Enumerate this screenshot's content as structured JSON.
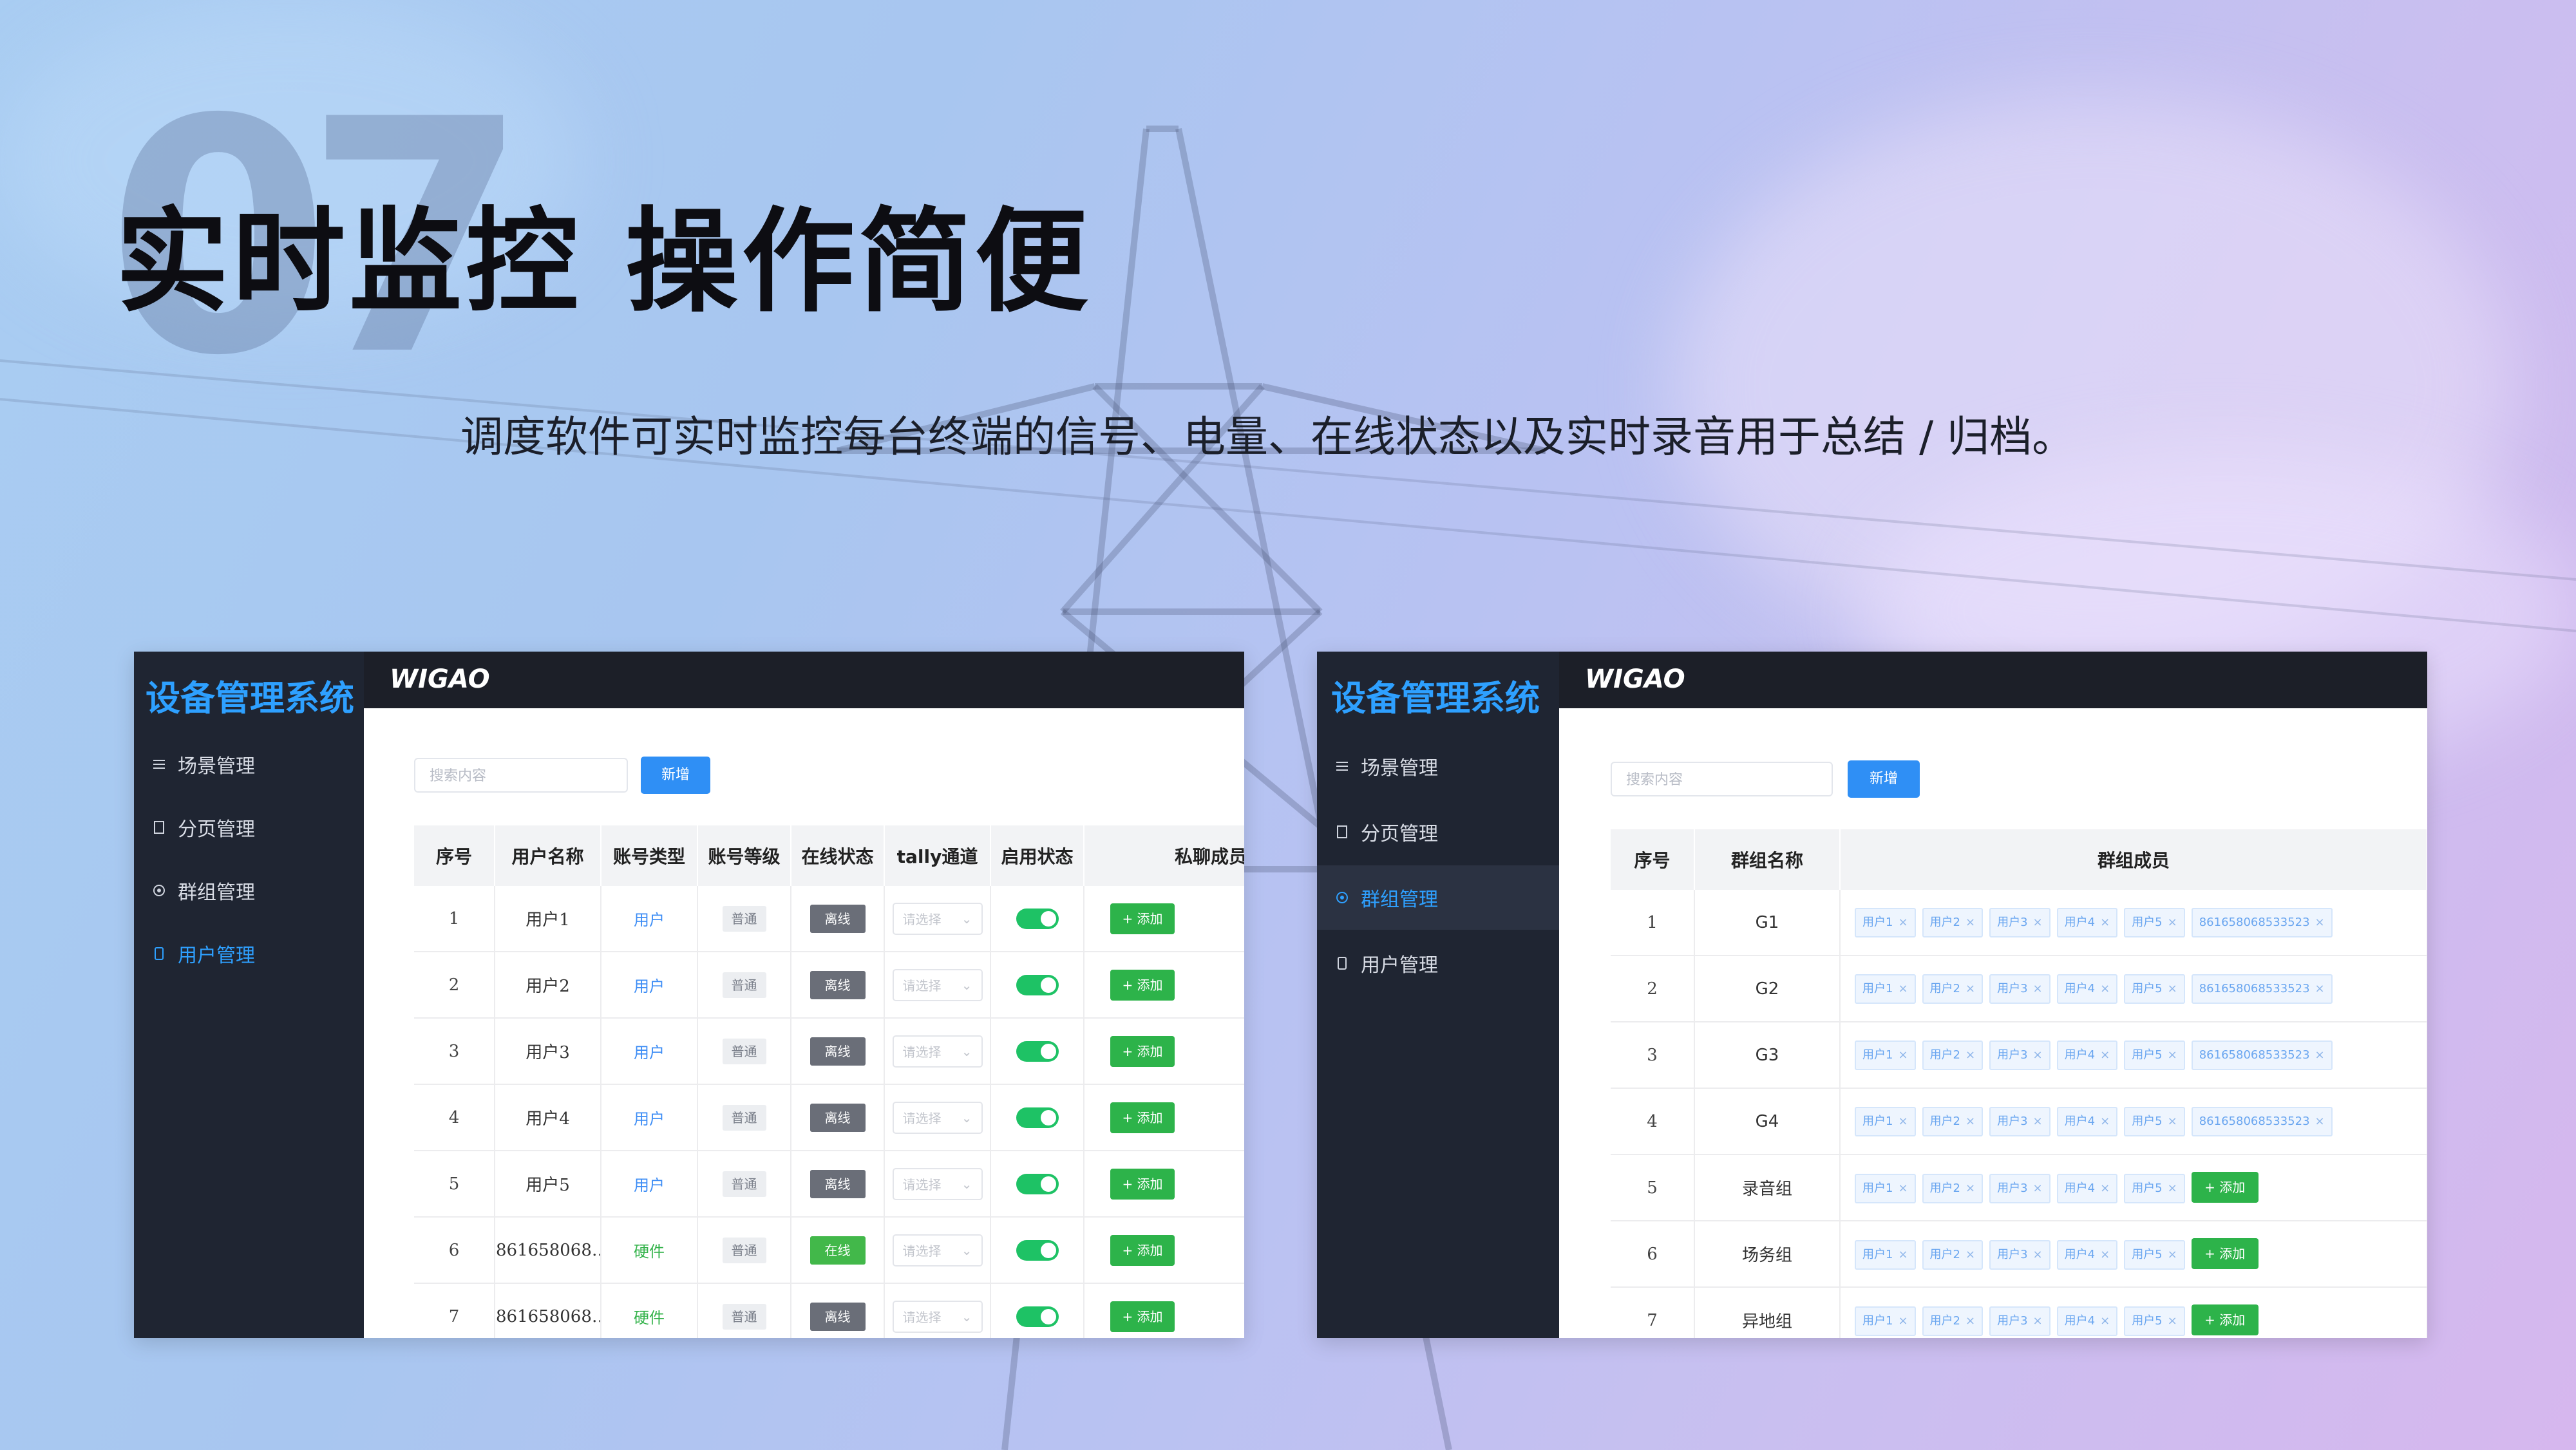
{
  "slide": {
    "number": "07",
    "title": "实时监控 操作简便",
    "subtitle": "调度软件可实时监控每台终端的信号、电量、在线状态以及实时录音用于总结 / 归档。"
  },
  "left_panel": {
    "brand": "设备管理系统",
    "logo": "WIGAO",
    "menu": [
      {
        "label": "场景管理",
        "icon": "sliders-icon"
      },
      {
        "label": "分页管理",
        "icon": "document-icon"
      },
      {
        "label": "群组管理",
        "icon": "target-icon"
      },
      {
        "label": "用户管理",
        "icon": "phone-icon",
        "active": true
      }
    ],
    "search_placeholder": "搜索内容",
    "new_button": "新增",
    "columns": [
      "序号",
      "用户名称",
      "账号类型",
      "账号等级",
      "在线状态",
      "tally通道",
      "启用状态",
      "私聊成员"
    ],
    "select_placeholder": "请选择",
    "add_button": "+ 添加",
    "rows": [
      {
        "no": "1",
        "name": "用户1",
        "type": "用户",
        "level": "普通",
        "status": "离线"
      },
      {
        "no": "2",
        "name": "用户2",
        "type": "用户",
        "level": "普通",
        "status": "离线"
      },
      {
        "no": "3",
        "name": "用户3",
        "type": "用户",
        "level": "普通",
        "status": "离线"
      },
      {
        "no": "4",
        "name": "用户4",
        "type": "用户",
        "level": "普通",
        "status": "离线"
      },
      {
        "no": "5",
        "name": "用户5",
        "type": "用户",
        "level": "普通",
        "status": "离线"
      },
      {
        "no": "6",
        "name": "861658068…",
        "type": "硬件",
        "level": "普通",
        "status": "在线"
      },
      {
        "no": "7",
        "name": "861658068…",
        "type": "硬件",
        "level": "普通",
        "status": "离线"
      }
    ]
  },
  "right_panel": {
    "brand": "设备管理系统",
    "logo": "WIGAO",
    "menu": [
      {
        "label": "场景管理",
        "icon": "sliders-icon"
      },
      {
        "label": "分页管理",
        "icon": "document-icon"
      },
      {
        "label": "群组管理",
        "icon": "target-icon",
        "active": true
      },
      {
        "label": "用户管理",
        "icon": "phone-icon"
      }
    ],
    "search_placeholder": "搜索内容",
    "new_button": "新增",
    "columns": [
      "序号",
      "群组名称",
      "群组成员"
    ],
    "add_button": "+ 添加",
    "rows": [
      {
        "no": "1",
        "name": "G1",
        "members": [
          "用户1",
          "用户2",
          "用户3",
          "用户4",
          "用户5",
          "861658068533523"
        ]
      },
      {
        "no": "2",
        "name": "G2",
        "members": [
          "用户1",
          "用户2",
          "用户3",
          "用户4",
          "用户5",
          "861658068533523"
        ]
      },
      {
        "no": "3",
        "name": "G3",
        "members": [
          "用户1",
          "用户2",
          "用户3",
          "用户4",
          "用户5",
          "861658068533523"
        ]
      },
      {
        "no": "4",
        "name": "G4",
        "members": [
          "用户1",
          "用户2",
          "用户3",
          "用户4",
          "用户5",
          "861658068533523"
        ]
      },
      {
        "no": "5",
        "name": "录音组",
        "members": [
          "用户1",
          "用户2",
          "用户3",
          "用户4",
          "用户5"
        ],
        "add": true
      },
      {
        "no": "6",
        "name": "场务组",
        "members": [
          "用户1",
          "用户2",
          "用户3",
          "用户4",
          "用户5"
        ],
        "add": true
      },
      {
        "no": "7",
        "name": "异地组",
        "members": [
          "用户1",
          "用户2",
          "用户3",
          "用户4",
          "用户5"
        ],
        "add": true
      }
    ]
  }
}
